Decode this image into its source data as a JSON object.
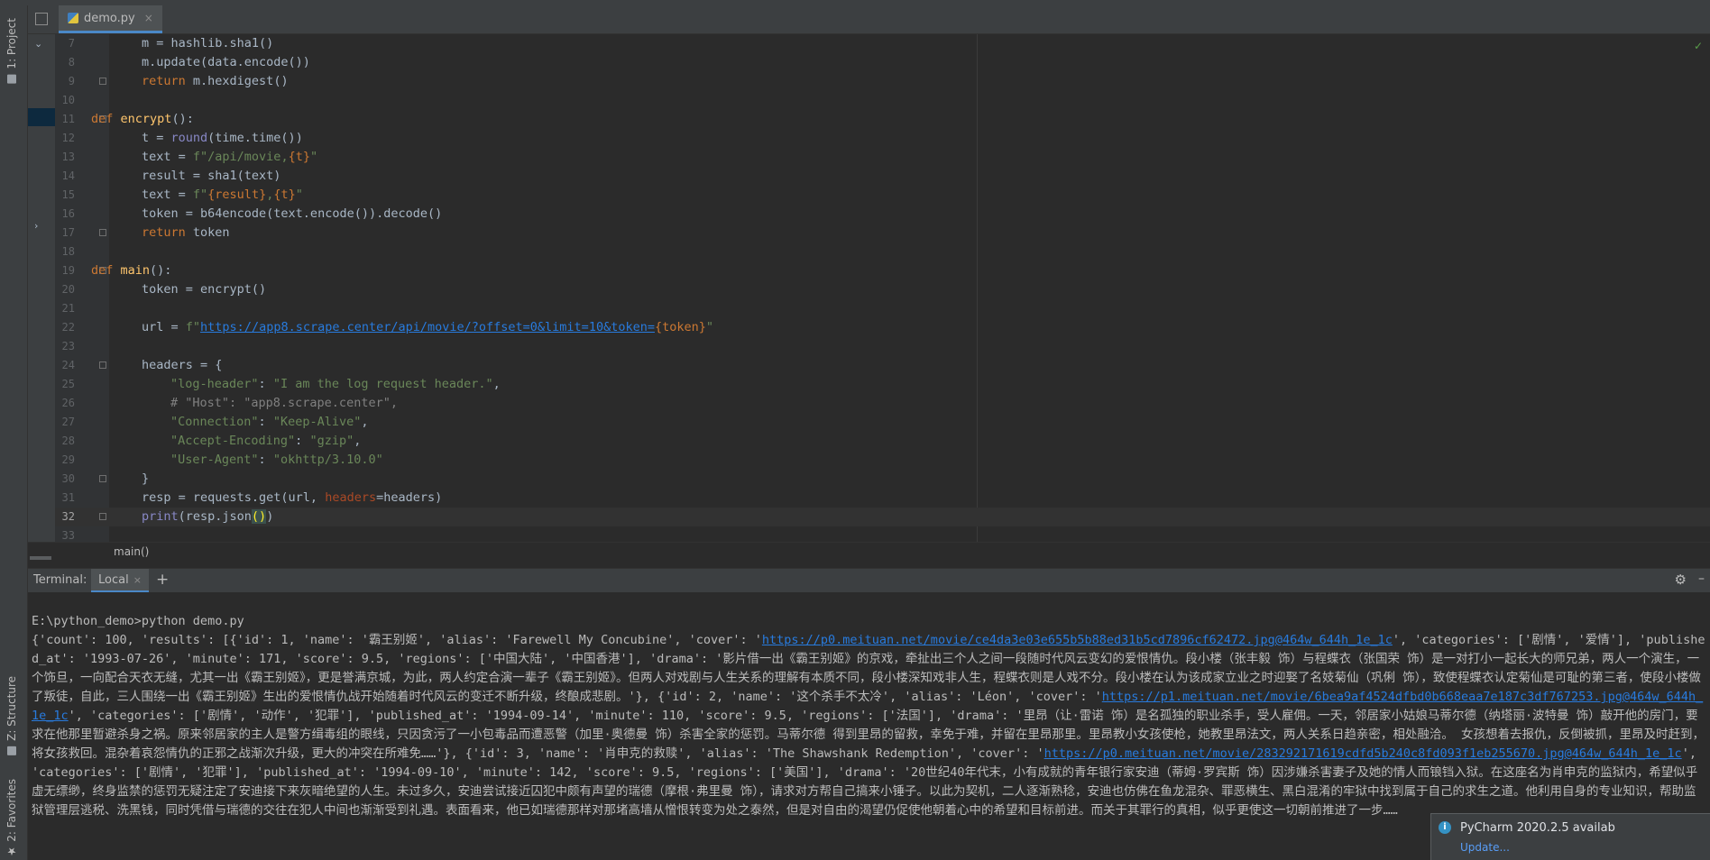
{
  "toolwindows": {
    "project": "1: Project",
    "structure": "Z: Structure",
    "favorites": "2: Favorites"
  },
  "editor_tab": {
    "filename": "demo.py",
    "close": "×"
  },
  "code_lines": [
    {
      "n": "7"
    },
    {
      "n": "8"
    },
    {
      "n": "9"
    },
    {
      "n": "10"
    },
    {
      "n": "11"
    },
    {
      "n": "12"
    },
    {
      "n": "13"
    },
    {
      "n": "14"
    },
    {
      "n": "15"
    },
    {
      "n": "16"
    },
    {
      "n": "17"
    },
    {
      "n": "18"
    },
    {
      "n": "19"
    },
    {
      "n": "20"
    },
    {
      "n": "21"
    },
    {
      "n": "22"
    },
    {
      "n": "23"
    },
    {
      "n": "24"
    },
    {
      "n": "25"
    },
    {
      "n": "26"
    },
    {
      "n": "27"
    },
    {
      "n": "28"
    },
    {
      "n": "29"
    },
    {
      "n": "30"
    },
    {
      "n": "31"
    },
    {
      "n": "32"
    },
    {
      "n": "33"
    }
  ],
  "code": {
    "l7": "m = hashlib.sha1()",
    "l8": "m.update(data.encode())",
    "l9_kw": "return",
    "l9": " m.hexdigest()",
    "l11_kw": "def",
    "l11_fn": "encrypt",
    "l11": "():",
    "l12_a": "t = ",
    "l12_bi": "round",
    "l12_b": "(time.time())",
    "l13_a": "text = ",
    "l13_s": "f\"/api/movie,",
    "l13_v": "{t}",
    "l13_e": "\"",
    "l14": "result = sha1(text)",
    "l15_a": "text = ",
    "l15_s1": "f\"",
    "l15_v1": "{result}",
    "l15_s2": ",",
    "l15_v2": "{t}",
    "l15_e": "\"",
    "l16": "token = b64encode(text.encode()).decode()",
    "l17_kw": "return",
    "l17": " token",
    "l19_kw": "def",
    "l19_fn": "main",
    "l19": "():",
    "l20": "token = encrypt()",
    "l22_a": "url = ",
    "l22_s": "f\"",
    "l22_url": "https://app8.scrape.center/api/movie/?offset=0&limit=10&token=",
    "l22_v": "{token}",
    "l22_e": "\"",
    "l24": "headers = {",
    "l25_k": "\"log-header\"",
    "l25_v": "\"I am the log request header.\"",
    "l26": "# \"Host\": \"app8.scrape.center\",",
    "l27_k": "\"Connection\"",
    "l27_v": "\"Keep-Alive\"",
    "l28_k": "\"Accept-Encoding\"",
    "l28_v": "\"gzip\"",
    "l29_k": "\"User-Agent\"",
    "l29_v": "\"okhttp/3.10.0\"",
    "l30": "}",
    "l31_a": "resp = requests.get(url, ",
    "l31_p": "headers",
    "l31_b": "=headers)",
    "l32_bi": "print",
    "l32_a": "(resp.json",
    "l32_br": "()",
    "l32_b": ")"
  },
  "breadcrumb": "main()",
  "terminal": {
    "label": "Terminal:",
    "tab": "Local",
    "tab_close": "×",
    "add": "+",
    "command": "E:\\python_demo>python demo.py",
    "out_1": "{'count': 100, 'results': [{'id': 1, 'name': '霸王别姬', 'alias': 'Farewell My Concubine', 'cover': '",
    "url_1": "https://p0.meituan.net/movie/ce4da3e03e655b5b88ed31b5cd7896cf62472.jpg@464w_644h_1e_1c",
    "out_2": "', 'categories': ['剧情', '爱情'], 'published_at': '1993-07-26', 'minute': 171, 'score': 9.5, 'regions': ['中国大陆', '中国香港'], 'drama': '影片借一出《霸王别姬》的京戏，牵扯出三个人之间一段随时代风云变幻的爱恨情仇。段小楼（张丰毅 饰）与程蝶衣（张国荣 饰）是一对打小一起长大的师兄弟，两人一个演生，一个饰旦，一向配合天衣无缝，尤其一出《霸王别姬》，更是誉满京城，为此，两人约定合演一辈子《霸王别姬》。但两人对戏剧与人生关系的理解有本质不同，段小楼深知戏非人生，程蝶衣则是人戏不分。段小楼在认为该成家立业之时迎娶了名妓菊仙（巩俐 饰），致使程蝶衣认定菊仙是可耻的第三者，使段小楼做了叛徒，自此，三人围绕一出《霸王别姬》生出的爱恨情仇战开始随着时代风云的变迁不断升级，终酿成悲剧。'}, {'id': 2, 'name': '这个杀手不太冷', 'alias': 'Léon', 'cover': '",
    "url_2": "https://p1.meituan.net/movie/6bea9af4524dfbd0b668eaa7e187c3df767253.jpg@464w_644h_1e_1c",
    "out_3": "', 'categories': ['剧情', '动作', '犯罪'], 'published_at': '1994-09-14', 'minute': 110, 'score': 9.5, 'regions': ['法国'], 'drama': '里昂（让·雷诺 饰）是名孤独的职业杀手，受人雇佣。一天，邻居家小姑娘马蒂尔德（纳塔丽·波特曼 饰）敲开他的房门，要求在他那里暂避杀身之祸。原来邻居家的主人是警方缉毒组的眼线，只因贪污了一小包毒品而遭恶警（加里·奥德曼 饰）杀害全家的惩罚。马蒂尔德 得到里昂的留救，幸免于难，并留在里昂那里。里昂教小女孩使枪，她教里昂法文，两人关系日趋亲密，相处融洽。 女孩想着去报仇，反倒被抓，里昂及时赶到，将女孩救回。混杂着哀怨情仇的正邪之战渐次升级，更大的冲突在所难免……'}, {'id': 3, 'name': '肖申克的救赎', 'alias': 'The Shawshank Redemption', 'cover': '",
    "url_3": "https://p0.meituan.net/movie/283292171619cdfd5b240c8fd093f1eb255670.jpg@464w_644h_1e_1c",
    "out_4": "', 'categories': ['剧情', '犯罪'], 'published_at': '1994-09-10', 'minute': 142, 'score': 9.5, 'regions': ['美国'], 'drama': '20世纪40年代末，小有成就的青年银行家安迪（蒂姆·罗宾斯 饰）因涉嫌杀害妻子及她的情人而锒铛入狱。在这座名为肖申克的监狱内，希望似乎虚无缥缈，终身监禁的惩罚无疑注定了安迪接下来灰暗绝望的人生。未过多久，安迪尝试接近囚犯中颇有声望的瑞德（摩根·弗里曼 饰），请求对方帮自己搞来小锤子。以此为契机，二人逐渐熟稔，安迪也仿佛在鱼龙混杂、罪恶横生、黑白混淆的牢狱中找到属于自己的求生之道。他利用自身的专业知识，帮助监狱管理层逃税、洗黑钱，同时凭借与瑞德的交往在犯人中间也渐渐受到礼遇。表面看来，他已如瑞德那样对那堵高墙从憎恨转变为处之泰然，但是对自由的渴望仍促使他朝着心中的希望和目标前进。而关于其罪行的真相，似乎更使这一切朝前推进了一步……"
  },
  "notification": {
    "title": "PyCharm 2020.2.5 availab",
    "link": "Update..."
  },
  "colors": {
    "background": "#2b2b2b",
    "keyword": "#cc7832",
    "string": "#6a8759",
    "function": "#ffc66d",
    "link": "#287bde"
  }
}
